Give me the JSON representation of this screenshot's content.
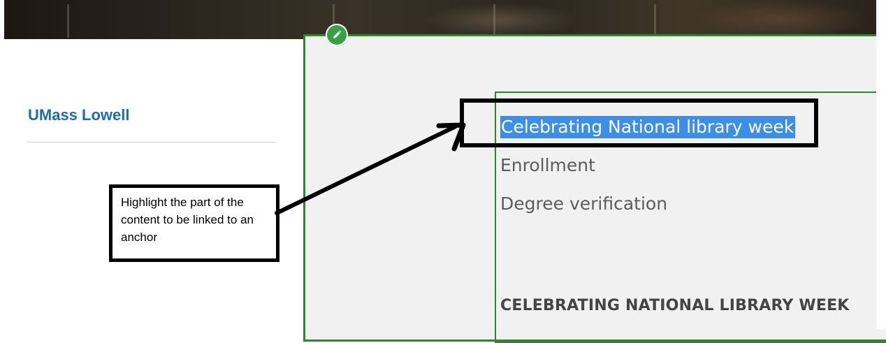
{
  "sidebar": {
    "site_name": "UMass Lowell"
  },
  "editor": {
    "edit_icon": "pencil-icon",
    "accent_color": "#2a8a2a",
    "links": [
      {
        "label": "Celebrating National library week",
        "highlighted": true
      },
      {
        "label": "Enrollment"
      },
      {
        "label": "Degree verification"
      }
    ],
    "section_heading": "CELEBRATING NATIONAL LIBRARY WEEK"
  },
  "annotation": {
    "callout_text": "Highlight the part of the content to be linked to an anchor",
    "highlight_color": "#3d8ee6"
  }
}
